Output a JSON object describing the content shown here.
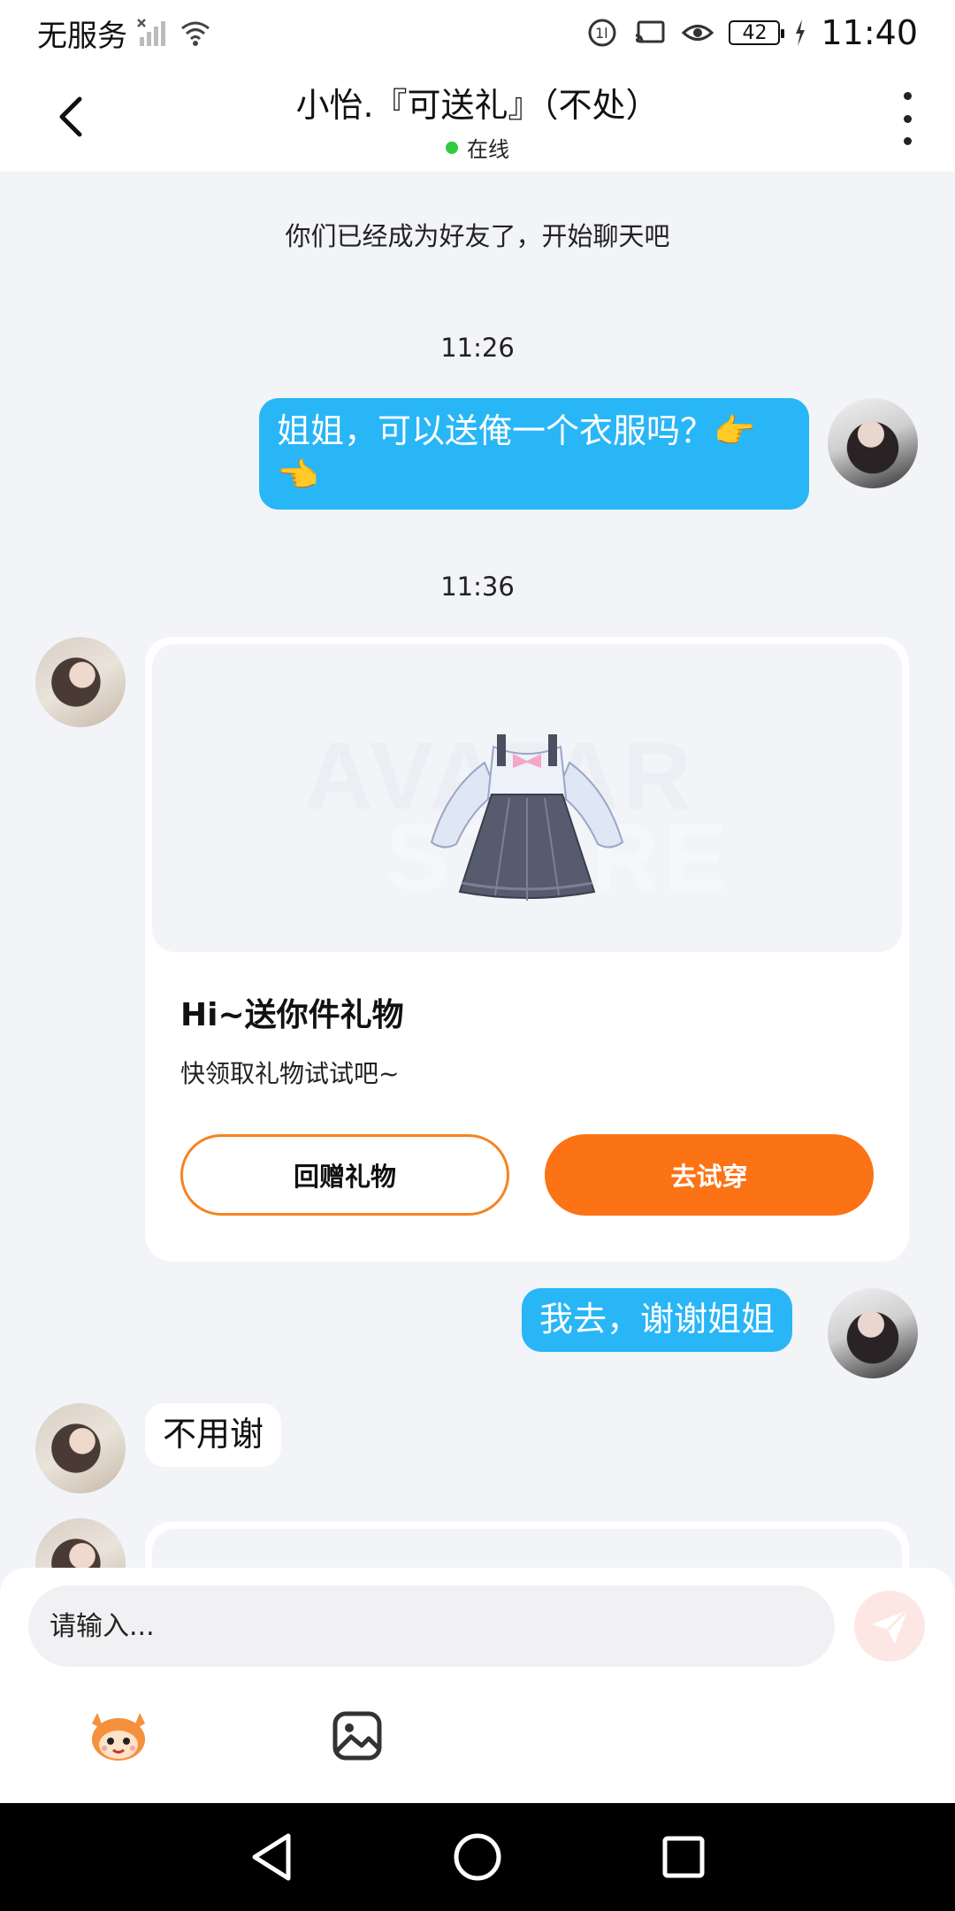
{
  "status_bar": {
    "carrier": "无服务",
    "battery": "42",
    "time": "11:40",
    "icons": [
      "signal-x-icon",
      "wifi-icon",
      "data-icon",
      "cast-icon",
      "eye-icon",
      "battery-icon",
      "charging-icon"
    ]
  },
  "header": {
    "title": "小怡.『可送礼』（不处）",
    "status": "在线",
    "status_color": "#2ecc40",
    "icons": [
      "back-chevron-icon",
      "more-vertical-icon"
    ]
  },
  "messages": {
    "friend_notice": "你们已经成为好友了，开始聊天吧",
    "time_1": "11:26",
    "msg_1": "姐姐，可以送俺一个衣服吗？👉👈",
    "time_2": "11:36",
    "msg_3": "我去，谢谢姐姐",
    "msg_4": "不用谢"
  },
  "gift_card": {
    "watermark_top": "AVATAR",
    "watermark_bottom": "STORE",
    "title": "Hi~送你件礼物",
    "subtitle": "快领取礼物试试吧~",
    "return_gift_label": "回赠礼物",
    "try_on_label": "去试穿",
    "accent_color": "#fb7315",
    "item_icon": "dress-icon"
  },
  "input": {
    "placeholder": "请输入...",
    "tools": [
      "mascot-sticker-icon",
      "image-icon",
      "send-icon"
    ]
  },
  "nav_bar": {
    "icons": [
      "nav-back-icon",
      "nav-home-icon",
      "nav-recent-icon"
    ]
  },
  "colors": {
    "outgoing_bubble": "#29b6f6",
    "background": "#f2f4f8"
  }
}
